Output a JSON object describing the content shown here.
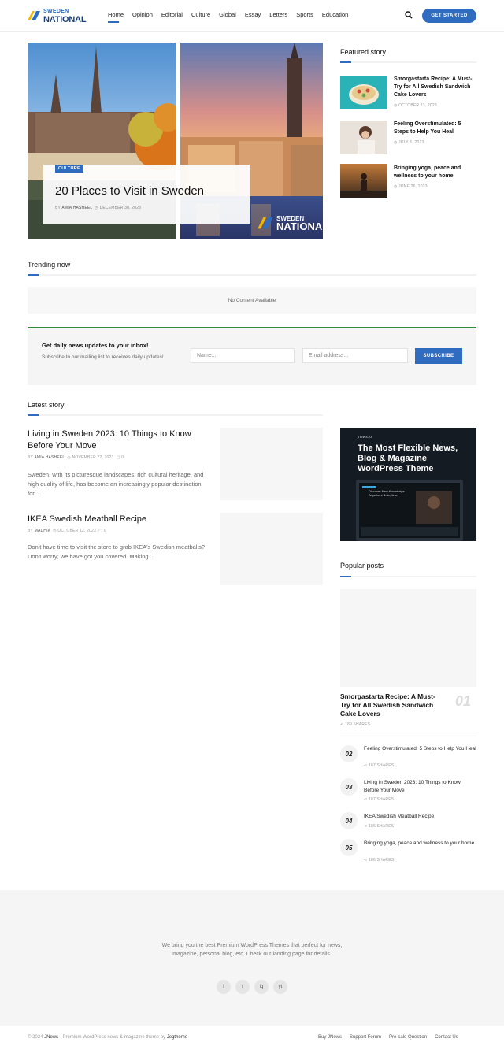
{
  "header": {
    "logo_small": "SWEDEN",
    "logo_big": "NATIONAL",
    "nav": [
      "Home",
      "Opinion",
      "Editorial",
      "Culture",
      "Global",
      "Essay",
      "Letters",
      "Sports",
      "Education"
    ],
    "cta": "GET STARTED"
  },
  "hero": {
    "category": "CULTURE",
    "title": "20 Places to Visit in Sweden",
    "by": "BY",
    "author": "AMIA HASHEEL",
    "date": "DECEMBER 30, 2023",
    "watermark_small": "SWEDEN",
    "watermark_big": "NATIONAL"
  },
  "featured": {
    "title": "Featured story",
    "items": [
      {
        "title": "Smorgastarta Recipe: A Must-Try for All Swedish Sandwich Cake Lovers",
        "date": "OCTOBER 13, 2023"
      },
      {
        "title": "Feeling Overstimulated: 5 Steps to Help You Heal",
        "date": "JULY 5, 2023"
      },
      {
        "title": "Bringing yoga, peace and wellness to your home",
        "date": "JUNE 26, 2023"
      }
    ]
  },
  "trending": {
    "title": "Trending now",
    "empty": "No Content Available"
  },
  "newsletter": {
    "title": "Get daily news updates to your inbox!",
    "subtitle": "Subscribe to our mailing list to receives daily updates!",
    "name_placeholder": "Name...",
    "email_placeholder": "Email address...",
    "button": "SUBSCRIBE"
  },
  "latest": {
    "title": "Latest story",
    "posts": [
      {
        "title": "Living in Sweden 2023: 10 Things to Know Before Your Move",
        "by": "BY",
        "author": "AMIA HASHEEL",
        "date": "NOVEMBER 22, 2023",
        "comments": "0",
        "excerpt": "Sweden, with its picturesque landscapes, rich cultural heritage, and high quality of life, has become an increasingly popular destination for..."
      },
      {
        "title": "IKEA Swedish Meatball Recipe",
        "by": "BY",
        "author": "MADHIA",
        "date": "OCTOBER 12, 2023",
        "comments": "0",
        "excerpt": "Don't have time to visit the store to grab IKEA's Swedish meatballs? Don't worry; we have got you covered. Making..."
      }
    ]
  },
  "ad": {
    "small": "jnews.io",
    "title": "The Most Flexible News, Blog & Magazine WordPress Theme",
    "screen_headline": "Discover New Knowledge Anywhere & Anytime"
  },
  "popular": {
    "title": "Popular posts",
    "first": {
      "num": "01",
      "title": "Smorgastarta Recipe: A Must-Try for All Swedish Sandwich Cake Lovers",
      "shares": "189 SHARES"
    },
    "items": [
      {
        "num": "02",
        "title": "Feeling Overstimulated: 5 Steps to Help You Heal",
        "shares": "187 SHARES"
      },
      {
        "num": "03",
        "title": "Living in Sweden 2023: 10 Things to Know Before Your Move",
        "shares": "187 SHARES"
      },
      {
        "num": "04",
        "title": "IKEA Swedish Meatball Recipe",
        "shares": "186 SHARES"
      },
      {
        "num": "05",
        "title": "Bringing yoga, peace and wellness to your home",
        "shares": "186 SHARES"
      }
    ]
  },
  "footer": {
    "text": "We bring you the best Premium WordPress Themes that perfect for news, magazine, personal blog, etc. Check our landing page for details.",
    "social": [
      "f",
      "t",
      "ig",
      "yt"
    ],
    "copy_prefix": "© 2024",
    "copy_brand": "JNews",
    "copy_mid": " - Premium WordPress news & magazine theme by ",
    "copy_author": "Jegtheme",
    "links": [
      "Buy JNews",
      "Support Forum",
      "Pre-sale Question",
      "Contact Us"
    ]
  },
  "colors": {
    "accent": "#2f6bbf",
    "newsletter_border": "#2f8a3c",
    "logo_dark": "#1c3f78"
  }
}
